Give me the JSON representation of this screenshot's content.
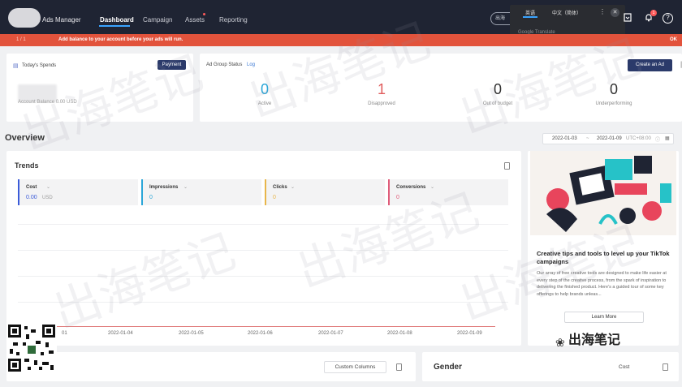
{
  "header": {
    "app_title": "Ads Manager",
    "nav": [
      "Dashboard",
      "Campaign",
      "Assets",
      "Reporting"
    ],
    "pill_text": "出海",
    "notification_count": "1"
  },
  "translate_popup": {
    "lang_a": "英语",
    "lang_b": "中文（简体）",
    "google_label": "Google Translate"
  },
  "alert": {
    "pager": "1 / 1",
    "message": "Add balance to your account before your ads will run.",
    "ok": "OK"
  },
  "spends": {
    "title": "Today's Spends",
    "payment": "Payment",
    "balance": "Account Balance 0.00 USD"
  },
  "ad_group": {
    "title": "Ad Group Status",
    "log": "Log",
    "create": "Create an Ad",
    "stats": [
      {
        "value": "0",
        "label": "Active",
        "color": "#2aa6d8"
      },
      {
        "value": "1",
        "label": "Disapproved",
        "color": "#e05c5c"
      },
      {
        "value": "0",
        "label": "Out of budget",
        "color": "#333333"
      },
      {
        "value": "0",
        "label": "Underperforming",
        "color": "#333333"
      }
    ]
  },
  "overview": {
    "title": "Overview",
    "date_start": "2022-01-03",
    "date_sep": "~",
    "date_end": "2022-01-09",
    "tz": "UTC+08:00"
  },
  "trends": {
    "title": "Trends",
    "metrics": [
      {
        "name": "Cost",
        "value": "0.00",
        "unit": "USD",
        "color": "#3b5bd9"
      },
      {
        "name": "Impressions",
        "value": "0",
        "unit": "",
        "color": "#2aa6d8"
      },
      {
        "name": "Clicks",
        "value": "0",
        "unit": "",
        "color": "#e8b64a"
      },
      {
        "name": "Conversions",
        "value": "0",
        "unit": "",
        "color": "#e05c7a"
      }
    ],
    "xticks": [
      "01",
      "2022-01-04",
      "2022-01-05",
      "2022-01-06",
      "2022-01-07",
      "2022-01-08",
      "2022-01-09"
    ]
  },
  "promo": {
    "title": "Creative tips and tools to level up your TikTok campaigns",
    "body": "Our array of free creative tools are designed to make life easier at every step of the creative process, from the spark of inspiration to delivering the finished product. Here's a guided tour of some key offerings to help brands unleas...",
    "button": "Learn More"
  },
  "bottom": {
    "custom_columns": "Custom Columns",
    "gender": "Gender",
    "cost": "Cost"
  },
  "watermark": {
    "text": "出海笔记",
    "brand": "出海笔记"
  }
}
